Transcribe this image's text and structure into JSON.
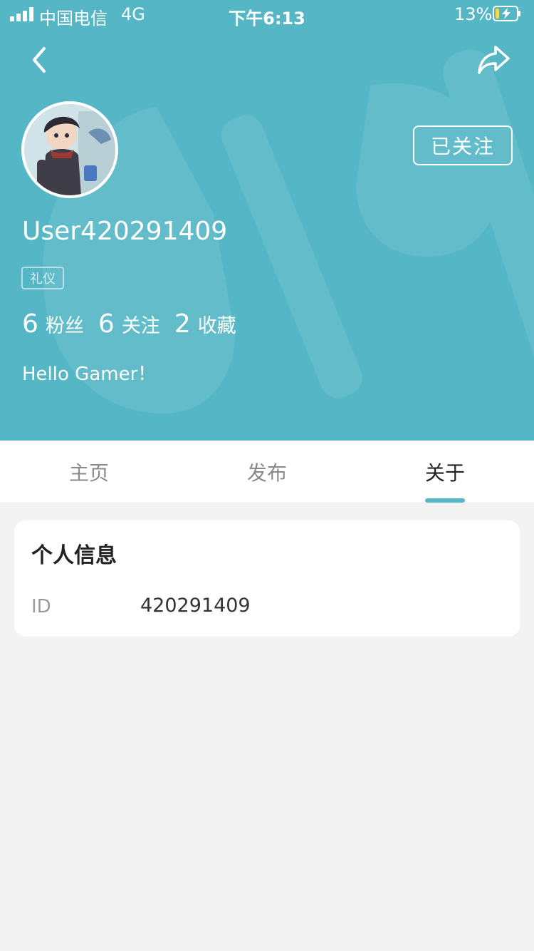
{
  "status_bar": {
    "carrier": "中国电信",
    "network": "4G",
    "time": "下午6:13",
    "battery": "13%"
  },
  "profile": {
    "username": "User420291409",
    "tag": "礼仪",
    "follow_label": "已关注",
    "bio": "Hello Gamer！",
    "stats": [
      {
        "num": "6",
        "label": "粉丝"
      },
      {
        "num": "6",
        "label": "关注"
      },
      {
        "num": "2",
        "label": "收藏"
      }
    ]
  },
  "tabs": [
    {
      "label": "主页"
    },
    {
      "label": "发布"
    },
    {
      "label": "关于"
    }
  ],
  "active_tab": "关于",
  "about": {
    "title": "个人信息",
    "id_label": "ID",
    "id_value": "420291409"
  },
  "colors": {
    "header": "#55b7c6",
    "accent": "#55b7c6",
    "page_bg": "#f3f3f3"
  },
  "icons": {
    "back": "chevron-left-icon",
    "share": "share-arrow-icon"
  }
}
